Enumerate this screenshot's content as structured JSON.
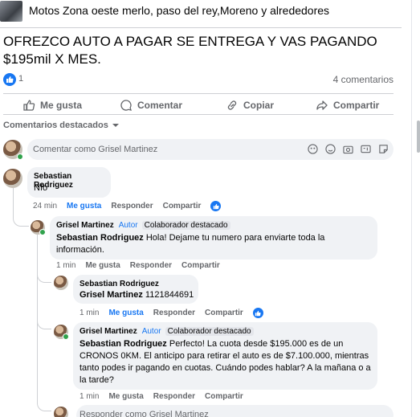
{
  "group": {
    "name": "Motos Zona oeste merlo, paso del rey,Moreno y alrededores"
  },
  "post": {
    "text": "OFREZCO AUTO A PAGAR SE ENTREGA Y VAS PAGANDO $195mil X MES.",
    "reaction_count": "1",
    "comments_count": "4 comentarios"
  },
  "actions": {
    "like": "Me gusta",
    "comment": "Comentar",
    "copy": "Copiar",
    "share": "Compartir"
  },
  "filter": {
    "label": "Comentarios destacados"
  },
  "composer": {
    "placeholder": "Comentar como Grisel Martinez"
  },
  "comments": [
    {
      "author": "Sebastian Rodriguez",
      "text": "Nfo",
      "time": "24 min",
      "like": "Me gusta",
      "reply": "Responder",
      "share": "Compartir"
    },
    {
      "author": "Grisel Martinez",
      "badge_author": "Autor",
      "badge_top": "Colaborador destacado",
      "mention": "Sebastian Rodriguez",
      "text": " Hola! Dejame tu numero para enviarte toda la información.",
      "time": "1 min",
      "like": "Me gusta",
      "reply": "Responder",
      "share": "Compartir"
    },
    {
      "author": "Sebastian Rodriguez",
      "mention": "Grisel Martinez",
      "text": " 1121844691",
      "time": "1 min",
      "like": "Me gusta",
      "reply": "Responder",
      "share": "Compartir"
    },
    {
      "author": "Grisel Martinez",
      "badge_author": "Autor",
      "badge_top": "Colaborador destacado",
      "mention": "Sebastian Rodriguez",
      "text": " Perfecto! La cuota desde $195.000 es de un CRONOS 0KM. El anticipo para retirar el auto es de $7.100.000, mientras tanto podes ir pagando en cuotas. Cuándo podes hablar? A la mañana o a la tarde?",
      "time": "1 min",
      "like": "Me gusta",
      "reply": "Responder",
      "share": "Compartir"
    }
  ],
  "reply_box": {
    "placeholder": "Responder como Grisel Martinez"
  },
  "colors": {
    "accent": "#1877f2",
    "bubble": "#f0f2f5",
    "muted": "#65676b"
  }
}
